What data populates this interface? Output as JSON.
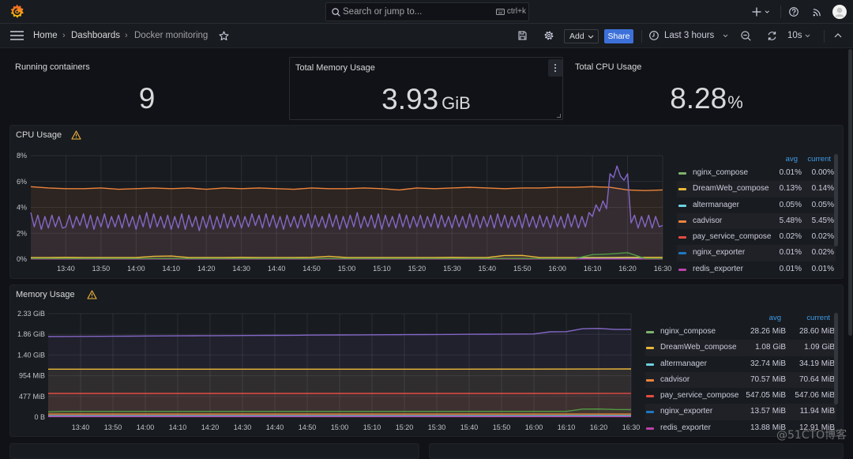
{
  "app": {
    "search_placeholder": "Search or jump to...",
    "search_shortcut": "ctrl+k"
  },
  "breadcrumb": {
    "home": "Home",
    "dashboards": "Dashboards",
    "current": "Docker monitoring",
    "separator": "›"
  },
  "toolbar": {
    "add_label": "Add",
    "share_label": "Share",
    "time_range": "Last 3 hours",
    "refresh_interval": "10s"
  },
  "theme": {
    "background": "#111217",
    "panel_background": "#181b1f",
    "accent": "#3d71d9",
    "warning": "#f5b73d",
    "legend_header": "#3d9be9"
  },
  "icons": {
    "logo": "grafana-logo-icon",
    "search": "search-icon",
    "shortcut": "keyboard-icon",
    "new": "plus-icon",
    "help": "help-icon",
    "news": "rss-icon",
    "profile": "avatar-icon",
    "menu": "hamburger-menu-icon",
    "favorite": "star-icon",
    "save": "save-icon",
    "settings": "gear-icon",
    "time": "clock-icon",
    "zoom_out": "zoom-out-icon",
    "refresh": "refresh-icon",
    "collapse": "chevron-up-icon",
    "panel_warning": "warning-icon",
    "panel_menu": "more-vertical-icon"
  },
  "stats": [
    {
      "title": "Running containers",
      "value": "9",
      "unit": ""
    },
    {
      "title": "Total Memory Usage",
      "value": "3.93",
      "unit": "GiB"
    },
    {
      "title": "Total CPU Usage",
      "value": "8.28",
      "unit": "%"
    }
  ],
  "panels": {
    "cpu": {
      "title": "CPU Usage",
      "has_warning": true
    },
    "memory": {
      "title": "Memory Usage",
      "has_warning": true
    }
  },
  "chart_data": [
    {
      "type": "line",
      "title": "CPU Usage",
      "xlabel": "",
      "ylabel": "",
      "x_range": [
        "13:30",
        "16:30"
      ],
      "x_ticks": [
        "13:40",
        "13:50",
        "14:00",
        "14:10",
        "14:20",
        "14:30",
        "14:40",
        "14:50",
        "15:00",
        "15:10",
        "15:20",
        "15:30",
        "15:40",
        "15:50",
        "16:00",
        "16:10",
        "16:20",
        "16:30"
      ],
      "y_unit": "%",
      "y_range": [
        0,
        8
      ],
      "y_ticks": [
        {
          "value": 0,
          "label": "0%"
        },
        {
          "value": 2,
          "label": "2%"
        },
        {
          "value": 4,
          "label": "4%"
        },
        {
          "value": 6,
          "label": "6%"
        },
        {
          "value": 8,
          "label": "8%"
        }
      ],
      "grid": true,
      "legend_placement": "right",
      "legend_columns": [
        "avg",
        "current"
      ],
      "series": [
        {
          "name": "nginx_compose",
          "color": "#7EB26D",
          "in_legend": true,
          "avg": "0.01%",
          "current": "0.00%",
          "start": "13:30",
          "step_minutes": 30,
          "values": [
            0.01,
            0.01,
            0.01,
            0.01,
            0.01,
            0.01,
            0.01
          ]
        },
        {
          "name": "DreamWeb_compose",
          "color": "#EAB839",
          "in_legend": true,
          "avg": "0.13%",
          "current": "0.14%",
          "start": "13:30",
          "step_minutes": 5,
          "values": [
            0.13,
            0.13,
            0.14,
            0.13,
            0.13,
            0.13,
            0.13,
            0.22,
            0.24,
            0.13,
            0.13,
            0.13,
            0.14,
            0.13,
            0.13,
            0.13,
            0.14,
            0.22,
            0.13,
            0.13,
            0.13,
            0.13,
            0.13,
            0.13,
            0.14,
            0.13,
            0.13,
            0.28,
            0.29,
            0.13,
            0.13,
            0.13,
            0.13,
            0.13,
            0.14,
            0.14,
            0.14
          ]
        },
        {
          "name": "altermanager",
          "color": "#6ED0E0",
          "in_legend": true,
          "avg": "0.05%",
          "current": "0.05%",
          "start": "13:30",
          "step_minutes": 30,
          "values": [
            0.05,
            0.05,
            0.05,
            0.05,
            0.05,
            0.05,
            0.05
          ]
        },
        {
          "name": "cadvisor",
          "color": "#EF843C",
          "in_legend": true,
          "avg": "5.48%",
          "current": "5.45%",
          "start": "13:30",
          "step_minutes": 5,
          "values": [
            5.6,
            5.5,
            5.45,
            5.45,
            5.5,
            5.4,
            5.45,
            5.5,
            5.45,
            5.5,
            5.4,
            5.5,
            5.45,
            5.5,
            5.45,
            5.4,
            5.5,
            5.45,
            5.45,
            5.5,
            5.45,
            5.35,
            5.5,
            5.45,
            5.5,
            5.55,
            5.5,
            5.45,
            5.5,
            5.5,
            5.55,
            5.55,
            5.6,
            5.55,
            5.35,
            5.3,
            5.35
          ]
        },
        {
          "name": "pay_service_compose",
          "color": "#E24D42",
          "in_legend": true,
          "avg": "0.02%",
          "current": "0.02%",
          "start": "13:30",
          "step_minutes": 30,
          "values": [
            0.02,
            0.02,
            0.02,
            0.02,
            0.02,
            0.02,
            0.02
          ]
        },
        {
          "name": "nginx_exporter",
          "color": "#1F78C1",
          "in_legend": true,
          "avg": "0.01%",
          "current": "0.02%",
          "start": "13:30",
          "step_minutes": 30,
          "values": [
            0.01,
            0.01,
            0.01,
            0.01,
            0.01,
            0.01,
            0.02
          ]
        },
        {
          "name": "redis_exporter",
          "color": "#BA43A9",
          "in_legend": true,
          "avg": "0.01%",
          "current": "0.01%",
          "start": "13:30",
          "step_minutes": 30,
          "values": [
            0.01,
            0.01,
            0.01,
            0.01,
            0.01,
            0.01,
            0.01
          ]
        },
        {
          "name": null,
          "color": "#8467C7",
          "in_legend": false,
          "start": "13:30",
          "step_minutes": 1,
          "values": [
            3.6,
            2.5,
            3.4,
            2.3,
            3.3,
            2.4,
            3.4,
            2.5,
            3.3,
            2.4,
            2.5,
            3.4,
            2.4,
            3.3,
            2.6,
            3.5,
            2.4,
            3.4,
            2.3,
            3.3,
            2.5,
            3.5,
            2.4,
            3.3,
            2.5,
            3.4,
            2.4,
            3.5,
            2.5,
            3.3,
            2.3,
            3.4,
            2.5,
            3.6,
            2.4,
            3.5,
            2.5,
            3.3,
            2.4,
            3.4,
            2.3,
            3.3,
            2.4,
            3.5,
            2.3,
            3.4,
            2.5,
            3.3,
            2.2,
            3.3,
            2.4,
            3.4,
            2.3,
            3.3,
            2.4,
            3.5,
            2.4,
            3.3,
            2.5,
            3.4,
            2.4,
            3.3,
            2.5,
            3.5,
            2.6,
            3.4,
            2.4,
            3.5,
            2.5,
            3.4,
            2.4,
            3.3,
            2.3,
            3.4,
            2.5,
            3.3,
            2.4,
            3.4,
            2.5,
            3.5,
            2.4,
            3.4,
            2.5,
            3.3,
            2.4,
            3.5,
            2.5,
            3.4,
            2.3,
            3.3,
            2.4,
            3.4,
            2.5,
            3.6,
            2.4,
            3.3,
            2.5,
            3.4,
            2.4,
            3.5,
            2.3,
            3.4,
            2.5,
            3.3,
            2.4,
            3.5,
            2.5,
            3.4,
            2.4,
            3.3,
            2.5,
            3.4,
            2.4,
            3.3,
            2.5,
            3.5,
            2.4,
            3.4,
            2.5,
            3.3,
            2.4,
            3.4,
            2.5,
            3.3,
            2.4,
            3.5,
            2.5,
            3.4,
            2.4,
            3.3,
            2.5,
            3.4,
            2.4,
            3.5,
            2.5,
            3.4,
            2.4,
            3.3,
            2.5,
            3.4,
            2.4,
            3.5,
            2.5,
            3.3,
            2.4,
            3.4,
            2.5,
            3.3,
            2.4,
            3.4,
            2.5,
            3.3,
            2.4,
            3.5,
            2.5,
            3.4,
            2.4,
            3.3,
            2.5,
            3.6,
            3.3,
            4.2,
            3.7,
            4.5,
            3.9,
            6.6,
            6.3,
            7.2,
            6.4,
            6.1,
            6.6,
            2.8,
            3.4,
            2.4,
            3.3,
            2.5,
            3.4,
            2.4,
            3.3,
            2.5,
            2.6
          ]
        },
        {
          "name": null,
          "color": "#529A43",
          "in_legend": false,
          "start": "13:30",
          "step_minutes": 5,
          "values": [
            0.05,
            0.05,
            0.05,
            0.05,
            0.05,
            0.05,
            0.05,
            0.05,
            0.05,
            0.05,
            0.05,
            0.05,
            0.05,
            0.05,
            0.05,
            0.05,
            0.05,
            0.05,
            0.05,
            0.05,
            0.05,
            0.05,
            0.05,
            0.05,
            0.05,
            0.05,
            0.05,
            0.05,
            0.05,
            0.05,
            0.05,
            0.05,
            0.35,
            0.4,
            0.5,
            0.05,
            0.05
          ]
        }
      ]
    },
    {
      "type": "line",
      "title": "Memory Usage",
      "xlabel": "",
      "ylabel": "",
      "x_range": [
        "13:30",
        "16:30"
      ],
      "x_ticks": [
        "13:40",
        "13:50",
        "14:00",
        "14:10",
        "14:20",
        "14:30",
        "14:40",
        "14:50",
        "15:00",
        "15:10",
        "15:20",
        "15:30",
        "15:40",
        "15:50",
        "16:00",
        "16:10",
        "16:20",
        "16:30"
      ],
      "y_unit": "MiB",
      "y_range": [
        0,
        2385
      ],
      "y_ticks": [
        {
          "value": 0,
          "label": "0 B"
        },
        {
          "value": 477,
          "label": "477 MiB"
        },
        {
          "value": 954,
          "label": "954 MiB"
        },
        {
          "value": 1431,
          "label": "1.40 GiB"
        },
        {
          "value": 1908,
          "label": "1.86 GiB"
        },
        {
          "value": 2385,
          "label": "2.33 GiB"
        }
      ],
      "grid": true,
      "legend_placement": "right",
      "legend_columns": [
        "avg",
        "current"
      ],
      "series": [
        {
          "name": "nginx_compose",
          "color": "#7EB26D",
          "in_legend": true,
          "avg": "28.26 MiB",
          "current": "28.60 MiB",
          "start": "13:30",
          "step_minutes": 30,
          "values": [
            28.0,
            28.1,
            28.2,
            28.3,
            28.3,
            28.4,
            28.6
          ]
        },
        {
          "name": "DreamWeb_compose",
          "color": "#EAB839",
          "in_legend": true,
          "avg": "1.08 GiB",
          "current": "1.09 GiB",
          "start": "13:30",
          "step_minutes": 30,
          "values": [
            1105,
            1105,
            1106,
            1106,
            1106,
            1107,
            1110
          ]
        },
        {
          "name": "altermanager",
          "color": "#6ED0E0",
          "in_legend": true,
          "avg": "32.74 MiB",
          "current": "34.19 MiB",
          "start": "13:30",
          "step_minutes": 30,
          "values": [
            32.0,
            32.0,
            32.5,
            33.0,
            33.0,
            33.5,
            34.2
          ]
        },
        {
          "name": "cadvisor",
          "color": "#EF843C",
          "in_legend": true,
          "avg": "70.57 MiB",
          "current": "70.64 MiB",
          "start": "13:30",
          "step_minutes": 30,
          "values": [
            70.5,
            70.5,
            70.6,
            70.6,
            70.6,
            70.6,
            70.6
          ]
        },
        {
          "name": "pay_service_compose",
          "color": "#E24D42",
          "in_legend": true,
          "avg": "547.05 MiB",
          "current": "547.06 MiB",
          "start": "13:30",
          "step_minutes": 30,
          "values": [
            547,
            547,
            547,
            547,
            547,
            547,
            547.1
          ]
        },
        {
          "name": "nginx_exporter",
          "color": "#1F78C1",
          "in_legend": true,
          "avg": "13.57 MiB",
          "current": "11.94 MiB",
          "start": "13:30",
          "step_minutes": 30,
          "values": [
            14.0,
            14.0,
            13.8,
            13.6,
            13.4,
            13.0,
            11.9
          ]
        },
        {
          "name": "redis_exporter",
          "color": "#BA43A9",
          "in_legend": true,
          "avg": "13.88 MiB",
          "current": "12.91 MiB",
          "start": "13:30",
          "step_minutes": 30,
          "values": [
            14.2,
            14.1,
            14.0,
            13.9,
            13.8,
            13.6,
            12.9
          ]
        },
        {
          "name": null,
          "color": "#8467C7",
          "in_legend": false,
          "start": "13:30",
          "step_minutes": 5,
          "values": [
            1857,
            1859,
            1861,
            1863,
            1865,
            1867,
            1869,
            1871,
            1873,
            1875,
            1877,
            1879,
            1881,
            1883,
            1885,
            1887,
            1889,
            1891,
            1893,
            1895,
            1897,
            1899,
            1901,
            1903,
            1905,
            1907,
            1909,
            1911,
            1913,
            1915,
            1918,
            1966,
            1970,
            2038,
            2045,
            2022,
            2022
          ]
        },
        {
          "name": null,
          "color": "#529A43",
          "in_legend": false,
          "start": "13:30",
          "step_minutes": 5,
          "values": [
            122,
            133,
            133,
            133,
            133,
            133,
            133,
            133,
            133,
            133,
            133,
            133,
            133,
            133,
            133,
            133,
            133,
            133,
            133,
            133,
            133,
            133,
            133,
            133,
            133,
            133,
            133,
            133,
            133,
            133,
            133,
            133,
            133,
            186,
            188,
            176,
            175
          ]
        }
      ]
    }
  ],
  "watermark": "@51CTO博客"
}
